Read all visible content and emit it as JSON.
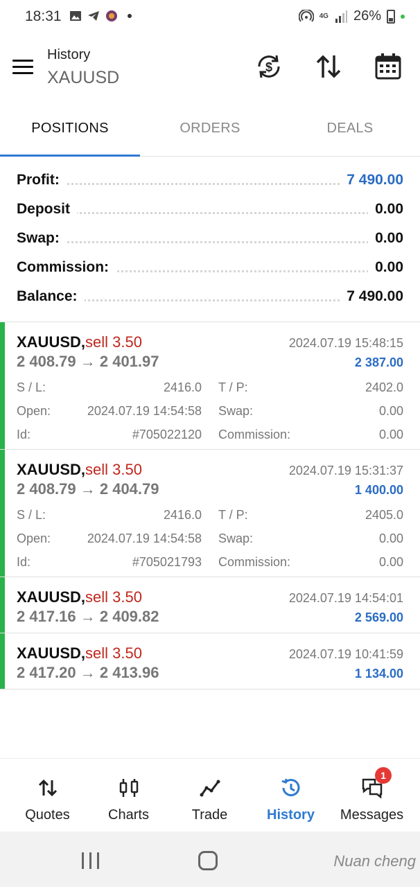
{
  "status_bar": {
    "time": "18:31",
    "network": "4G",
    "battery": "26%"
  },
  "header": {
    "title": "History",
    "symbol": "XAUUSD"
  },
  "tabs": [
    {
      "label": "POSITIONS",
      "active": true
    },
    {
      "label": "ORDERS",
      "active": false
    },
    {
      "label": "DEALS",
      "active": false
    }
  ],
  "summary": [
    {
      "label": "Profit:",
      "value": "7 490.00",
      "highlight": true
    },
    {
      "label": "Deposit",
      "value": "0.00",
      "highlight": false
    },
    {
      "label": "Swap:",
      "value": "0.00",
      "highlight": false
    },
    {
      "label": "Commission:",
      "value": "0.00",
      "highlight": false
    },
    {
      "label": "Balance:",
      "value": "7 490.00",
      "highlight": false
    }
  ],
  "positions": [
    {
      "symbol": "XAUUSD,",
      "side": "sell 3.50",
      "time": "2024.07.19 15:48:15",
      "prices": "2 408.79 → 2 401.97",
      "profit": "2 387.00",
      "details": {
        "sl_label": "S / L:",
        "sl": "2416.0",
        "tp_label": "T / P:",
        "tp": "2402.0",
        "open_label": "Open:",
        "open": "2024.07.19 14:54:58",
        "swap_label": "Swap:",
        "swap": "0.00",
        "id_label": "Id:",
        "id": "#705022120",
        "commission_label": "Commission:",
        "commission": "0.00"
      }
    },
    {
      "symbol": "XAUUSD,",
      "side": "sell 3.50",
      "time": "2024.07.19 15:31:37",
      "prices": "2 408.79 → 2 404.79",
      "profit": "1 400.00",
      "details": {
        "sl_label": "S / L:",
        "sl": "2416.0",
        "tp_label": "T / P:",
        "tp": "2405.0",
        "open_label": "Open:",
        "open": "2024.07.19 14:54:58",
        "swap_label": "Swap:",
        "swap": "0.00",
        "id_label": "Id:",
        "id": "#705021793",
        "commission_label": "Commission:",
        "commission": "0.00"
      }
    },
    {
      "symbol": "XAUUSD,",
      "side": "sell 3.50",
      "time": "2024.07.19 14:54:01",
      "prices": "2 417.16 → 2 409.82",
      "profit": "2 569.00"
    },
    {
      "symbol": "XAUUSD,",
      "side": "sell 3.50",
      "time": "2024.07.19 10:41:59",
      "prices": "2 417.20 → 2 413.96",
      "profit": "1 134.00"
    }
  ],
  "bottom_nav": [
    {
      "label": "Quotes",
      "icon": "quotes-arrows-icon",
      "active": false
    },
    {
      "label": "Charts",
      "icon": "candlestick-icon",
      "active": false
    },
    {
      "label": "Trade",
      "icon": "trade-line-icon",
      "active": false
    },
    {
      "label": "History",
      "icon": "history-clock-icon",
      "active": true
    },
    {
      "label": "Messages",
      "icon": "messages-bubble-icon",
      "active": false,
      "badge": "1"
    }
  ],
  "watermark": "Nuan cheng",
  "colors": {
    "accent_blue": "#2f7ad1",
    "profit_blue": "#2a6cc4",
    "sell_red": "#c0271d",
    "position_green": "#2ab24a",
    "badge_red": "#e53935"
  }
}
